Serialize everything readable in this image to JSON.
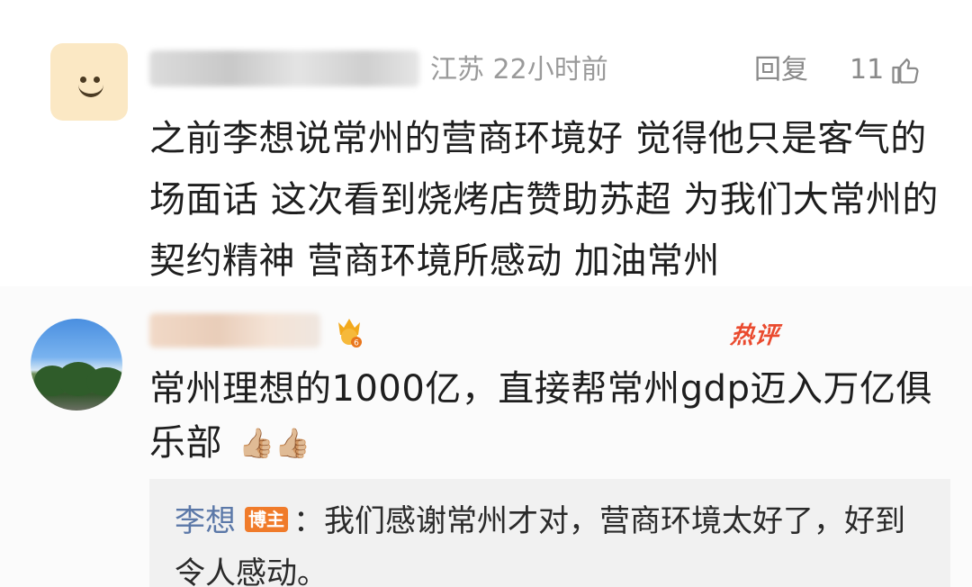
{
  "comment1": {
    "avatar_icon": "smiley-icon",
    "location_time": "江苏 22小时前",
    "reply_label": "回复",
    "like_count": "11",
    "like_icon": "thumbs-up-icon",
    "text": "之前李想说常州的营商环境好 觉得他只是客气的场面话 这次看到烧烤店赞助苏超 为我们大常州的契约精神 营商环境所感动 加油常州"
  },
  "comment2": {
    "avatar_icon": "landscape-avatar",
    "fan_badge_icon": "fan-level-badge-icon",
    "hot_tag": "热评",
    "text": "常州理想的1000亿，直接帮常州gdp迈入万亿俱乐部",
    "thumbs": "👍🏼👍🏼",
    "reply": {
      "author": "李想",
      "badge": "博主",
      "separator": "：",
      "text": "我们感谢常州才对，营商环境太好了，好到令人感动。"
    }
  },
  "colors": {
    "reply_author": "#5b78a8",
    "blogger_badge": "#f07b2a",
    "hot_tag": "#ea4a2e",
    "meta_grey": "#9a9a9a"
  }
}
